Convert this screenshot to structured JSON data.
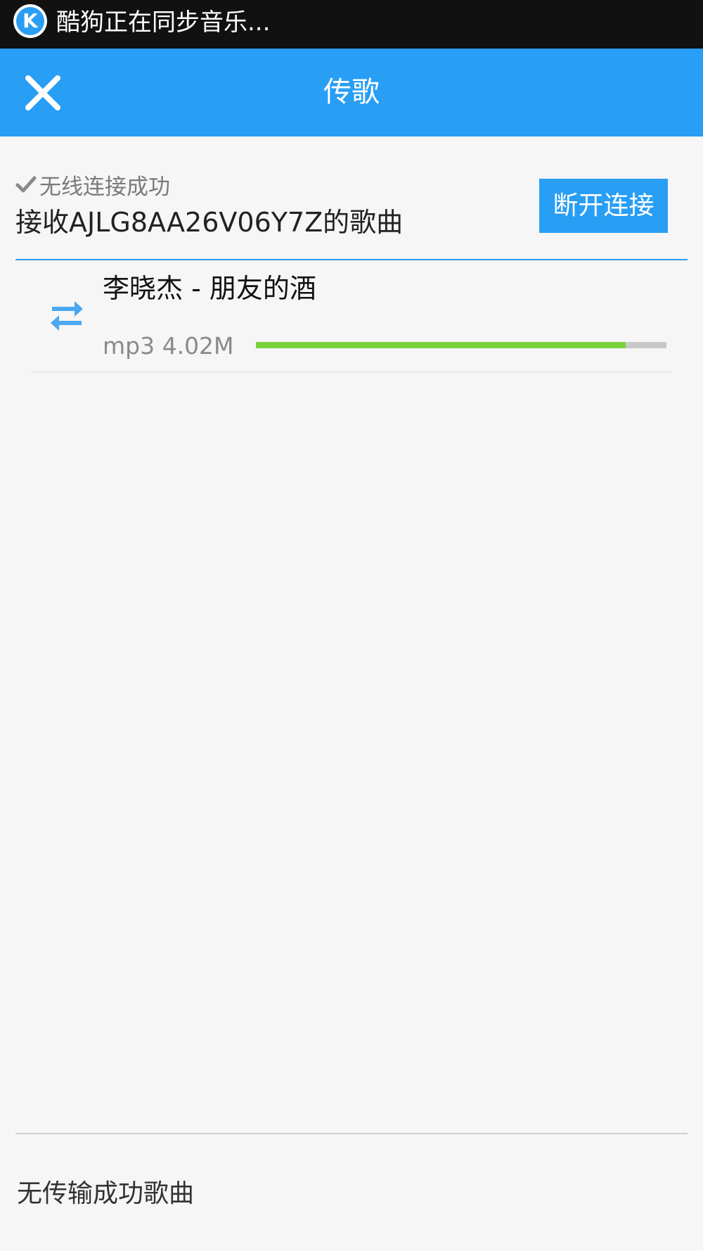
{
  "status_bar": {
    "app_icon": "kugou-k-icon",
    "app_icon_letter": "K",
    "notification_text": "酷狗正在同步音乐..."
  },
  "title_bar": {
    "title": "传歌",
    "close_icon": "close-icon"
  },
  "connection": {
    "status_icon": "check-icon",
    "status_text": "无线连接成功",
    "receive_label": "接收AJLG8AA26V06Y7Z的歌曲",
    "disconnect_label": "断开连接"
  },
  "transfers": [
    {
      "icon": "transfer-arrows-icon",
      "title": "李晓杰 - 朋友的酒",
      "meta": "mp3 4.02M",
      "progress": 0.9
    }
  ],
  "footer": {
    "no_success_text": "无传输成功歌曲"
  },
  "colors": {
    "accent": "#289ef5",
    "progress": "#7bd13a",
    "status_bar": "#111111",
    "background": "#f6f6f6"
  }
}
